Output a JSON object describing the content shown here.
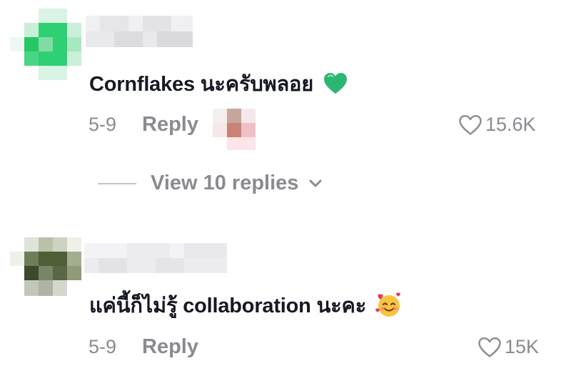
{
  "colors": {
    "text_primary": "#161823",
    "text_secondary": "#8a8b91",
    "heart_green": "#2bb673"
  },
  "comments": [
    {
      "text": "Cornflakes นะครับพลอย",
      "emoji_icon": "green-heart-icon",
      "date": "5-9",
      "reply_label": "Reply",
      "like_count": "15.6K",
      "view_replies_label": "View 10 replies"
    },
    {
      "text": "แค่นี้ก็ไม่รู้ collaboration นะคะ",
      "emoji_icon": "smiling-face-with-hearts-icon",
      "date": "5-9",
      "reply_label": "Reply",
      "like_count": "15K"
    }
  ]
}
